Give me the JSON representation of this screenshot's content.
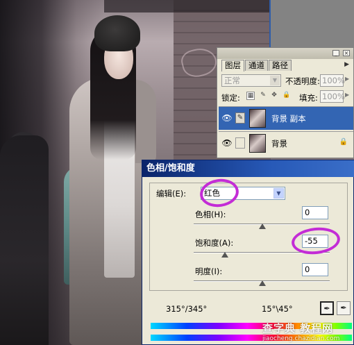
{
  "layers_panel": {
    "tabs": [
      "图层",
      "通道",
      "路径"
    ],
    "blend_mode": "正常",
    "opacity_label": "不透明度:",
    "opacity_value": "100%",
    "lock_label": "锁定:",
    "fill_label": "填充:",
    "fill_value": "100%",
    "layers": [
      {
        "name": "背景 副本",
        "selected": true
      },
      {
        "name": "背景",
        "selected": false
      }
    ],
    "colors": {
      "selected_row": "#3365b3",
      "panel_bg": "#ece9d8"
    }
  },
  "dialog": {
    "title": "色相/饱和度",
    "edit_label": "编辑(E):",
    "edit_value": "红色",
    "hue_label": "色相(H):",
    "hue_value": "0",
    "saturation_label": "饱和度(A):",
    "saturation_value": "-55",
    "lightness_label": "明度(I):",
    "lightness_value": "0",
    "range_left": "315°/345°",
    "range_right": "15°\\45°",
    "colors": {
      "title_bar": "#0a246a",
      "highlight_ring": "#c32cd6"
    }
  },
  "icons": [
    "eye-icon",
    "brush-icon",
    "lock-icon",
    "eyedropper-icon",
    "eyedropper-plus-icon",
    "close-icon",
    "menu-arrow-icon"
  ],
  "watermark": {
    "main": "查字典 教程网",
    "sub": "jiaocheng.chazidian.com"
  }
}
